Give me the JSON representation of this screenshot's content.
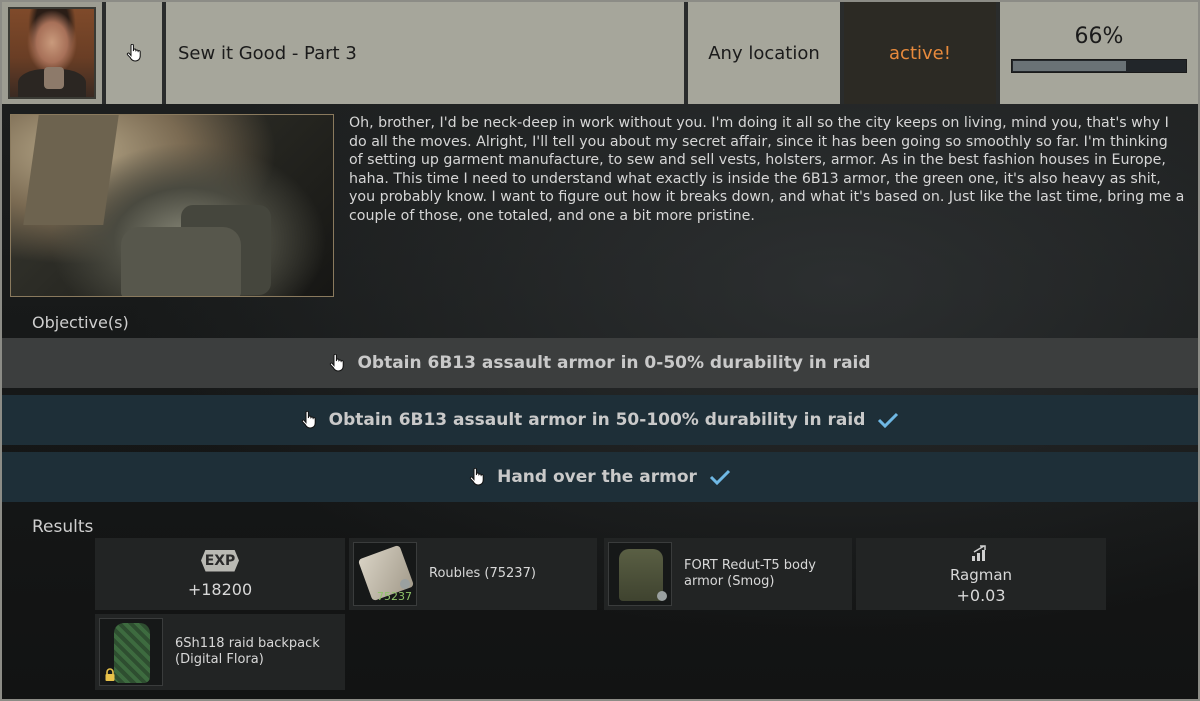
{
  "quest": {
    "title": "Sew it Good - Part 3",
    "location": "Any location",
    "status": "active!",
    "progress_text": "66%",
    "progress_fraction": 0.66,
    "description": "Oh, brother, I'd be neck-deep in work without you. I'm doing it all so the city keeps on living, mind you, that's why I do all the moves. Alright, I'll tell you about my secret affair, since it has been going so smoothly so far. I'm thinking of setting up garment manufacture, to sew and sell vests, holsters, armor. As in the best fashion houses in Europe, haha. This time I need to understand what exactly is inside the 6B13 armor, the green one, it's also heavy as shit, you probably know. I want to figure out how it breaks down, and what it's based on. Just like the last time, bring me a couple of those, one totaled, and one a bit more pristine."
  },
  "objectives_title": "Objective(s)",
  "objectives": [
    {
      "label": "Obtain 6B13 assault armor in 0-50% durability in raid",
      "completed": false
    },
    {
      "label": "Obtain 6B13 assault armor in 50-100% durability in raid",
      "completed": true
    },
    {
      "label": "Hand over the armor",
      "completed": true
    }
  ],
  "results_title": "Results",
  "results": {
    "exp_badge": "EXP",
    "exp_value": "+18200",
    "roubles_label": "Roubles (75237)",
    "roubles_qty": "75237",
    "armor_label": "FORT Redut-T5 body armor (Smog)",
    "rep_trader": "Ragman",
    "rep_value": "+0.03",
    "backpack_label": "6Sh118 raid backpack (Digital Flora)"
  },
  "colors": {
    "header_bg": "#a6a69b",
    "status_text": "#e88a3c",
    "objective_done_bg": "#1e2f38",
    "objective_pending_bg": "#3c3e3e",
    "check": "#6fb8e4"
  },
  "icons": {
    "trader_avatar": "trader-portrait",
    "hand": "hand-pointer-icon",
    "check": "checkmark-icon",
    "reputation": "reputation-up-icon",
    "lock": "lock-icon"
  }
}
